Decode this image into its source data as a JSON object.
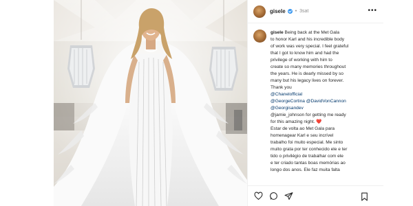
{
  "post": {
    "username": "gisele",
    "time_ago": "3sat",
    "separator": "•",
    "more_icon": "more-horizontal-icon",
    "caption_username": "gisele",
    "caption_lines": [
      "Being back at the Met Gala",
      "to honor Karl and his incredible body",
      "of work was very special. I feel grateful",
      "that I got to know him and had the",
      "privilege of working with him to",
      "create so many memories throughout",
      "the years. He is dearly missed by so",
      "many but his legacy lives on forever.",
      "Thank you"
    ],
    "mentions": [
      "@Chanelofficial",
      "@GeorgeCortina @DavidVonCannon",
      "@Georgisandev"
    ],
    "after_mentions": [
      "@jamie_johnson for getting me ready",
      "for this amazing night. ❤️"
    ],
    "portuguese_lines": [
      "Estar de volta ao Met Gala para",
      "homenagear Karl e seu incrível",
      "trabalho foi muito especial. Me sinto",
      "muito grata por ter conhecido ele e ter",
      "tido o privilégio de trabalhar com ele",
      "e ter criado tantas boas memórias ao",
      "longo dos anos. Ele faz muita falta"
    ]
  },
  "actions": {
    "like": "heart-icon",
    "comment": "comment-icon",
    "share": "send-icon",
    "save": "bookmark-icon"
  },
  "colors": {
    "link": "#00376b",
    "verified": "#3897f0",
    "text": "#262626",
    "muted": "#8e8e8e"
  }
}
